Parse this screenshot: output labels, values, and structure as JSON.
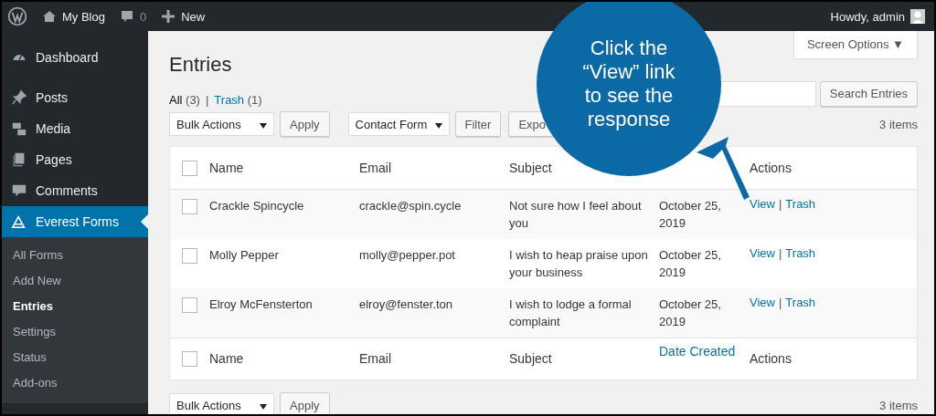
{
  "admin_bar": {
    "site": "My Blog",
    "comments": "0",
    "new": "New",
    "greeting": "Howdy, admin"
  },
  "sidebar": {
    "items": [
      {
        "label": "Dashboard",
        "selected": false
      },
      {
        "label": "Posts",
        "selected": false
      },
      {
        "label": "Media",
        "selected": false
      },
      {
        "label": "Pages",
        "selected": false
      },
      {
        "label": "Comments",
        "selected": false
      },
      {
        "label": "Everest Forms",
        "selected": true
      }
    ],
    "submenu": [
      {
        "label": "All Forms",
        "selected": false
      },
      {
        "label": "Add New",
        "selected": false
      },
      {
        "label": "Entries",
        "selected": true
      },
      {
        "label": "Settings",
        "selected": false
      },
      {
        "label": "Status",
        "selected": false
      },
      {
        "label": "Add-ons",
        "selected": false
      }
    ]
  },
  "screen_options": "Screen Options ▼",
  "title": "Entries",
  "views": [
    {
      "label": "All",
      "count": "(3)",
      "selected": true
    },
    {
      "label": "Trash",
      "count": "(1)",
      "selected": false
    }
  ],
  "views_separator": "|",
  "search_button": "Search Entries",
  "top_actions": {
    "bulk": "Bulk Actions",
    "apply": "Apply",
    "form": "Contact Form",
    "filter": "Filter",
    "export": "Expo",
    "count": "3 items"
  },
  "table": {
    "header": {
      "checked": false,
      "name": "Name",
      "email": "Email",
      "subject": "Subject",
      "actions": "Actions"
    },
    "footer": {
      "checked": false,
      "columns": [
        "Name",
        "Email",
        "Subject",
        "Date Created",
        "Actions"
      ]
    },
    "rows": [
      {
        "checked": false,
        "name": "Crackle Spincycle",
        "email": "crackle@spin.cycle",
        "subject": "Not sure how I feel about you",
        "date": "October 25, 2019",
        "actions": [
          "View",
          "|",
          "Trash"
        ]
      },
      {
        "checked": false,
        "name": "Molly Pepper",
        "email": "molly@pepper.pot",
        "subject": "I wish to heap praise upon your business",
        "date": "October 25, 2019",
        "actions": [
          "View",
          "|",
          "Trash"
        ]
      },
      {
        "checked": false,
        "name": "Elroy McFensterton",
        "email": "elroy@fenster.ton",
        "subject": "I wish to lodge a formal complaint",
        "date": "October 25, 2019",
        "actions": [
          "View",
          "|",
          "Trash"
        ]
      }
    ]
  },
  "bottom_actions": {
    "bulk": "Bulk Actions",
    "apply": "Apply",
    "count": "3 items"
  },
  "callout": "Click the “View” link to see the response"
}
